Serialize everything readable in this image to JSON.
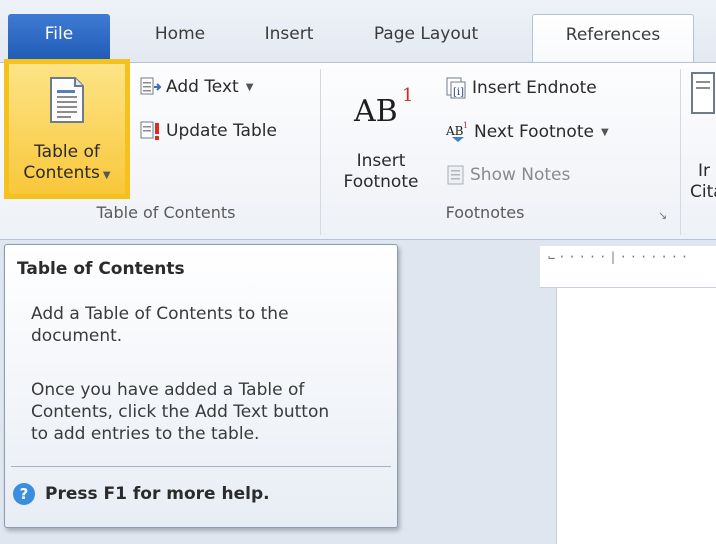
{
  "tabs": {
    "file": "File",
    "home": "Home",
    "insert": "Insert",
    "page_layout": "Page Layout",
    "references": "References"
  },
  "ribbon": {
    "toc_group": {
      "label": "Table of Contents",
      "toc_button_line1": "Table of",
      "toc_button_line2": "Contents",
      "add_text": "Add Text",
      "update_table": "Update Table"
    },
    "footnotes_group": {
      "label": "Footnotes",
      "insert_footnote_line1": "Insert",
      "insert_footnote_line2": "Footnote",
      "insert_endnote": "Insert Endnote",
      "next_footnote": "Next Footnote",
      "show_notes": "Show Notes"
    },
    "citation_partial": {
      "line1": "Ir",
      "line2": "Cita"
    }
  },
  "tooltip": {
    "title": "Table of Contents",
    "para1_line1": "Add a Table of Contents to the",
    "para1_line2": "document.",
    "para2_line1": "Once you have added a Table of",
    "para2_line2": "Contents, click the Add Text button",
    "para2_line3": "to add entries to the table.",
    "help": "Press F1 for more help."
  },
  "colors": {
    "file_tab": "#2b6ac6",
    "highlight": "#f9c73a",
    "help_icon": "#3a8de0"
  }
}
